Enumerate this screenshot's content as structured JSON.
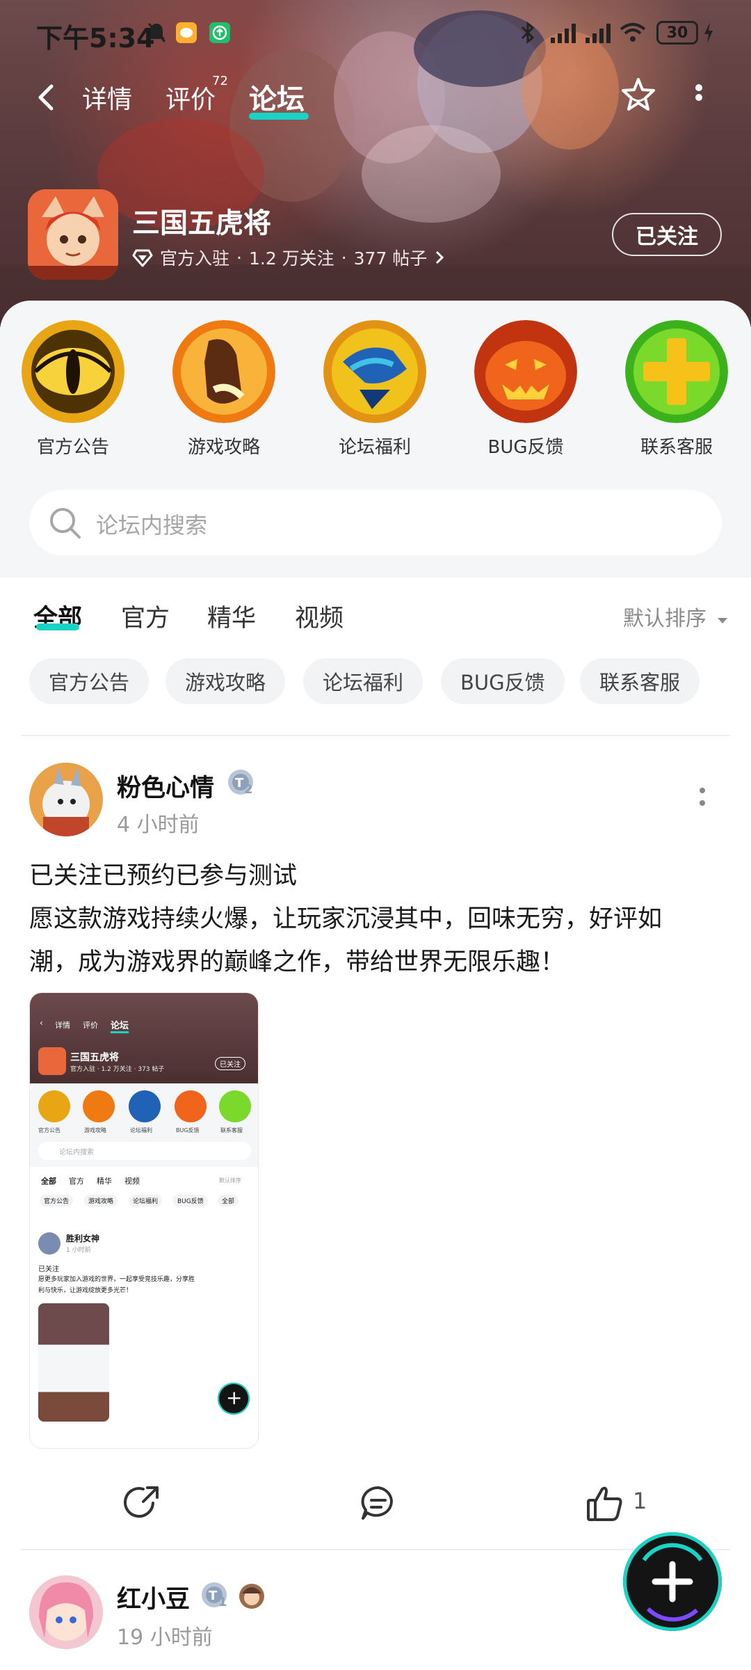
{
  "status_bar": {
    "time": "下午5:34",
    "battery": "30"
  },
  "top_nav": {
    "tabs": [
      {
        "label": "详情"
      },
      {
        "label": "评价",
        "badge": "72"
      },
      {
        "label": "论坛",
        "active": true
      }
    ]
  },
  "game": {
    "title": "三国五虎将",
    "official_label": "官方入驻",
    "followers": "1.2 万关注",
    "posts": "377 帖子",
    "follow_button": "已关注"
  },
  "quick_entries": [
    {
      "label": "官方公告",
      "icon": "cat-eye-icon"
    },
    {
      "label": "游戏攻略",
      "icon": "fist-icon"
    },
    {
      "label": "论坛福利",
      "icon": "gift-hand-icon"
    },
    {
      "label": "BUG反馈",
      "icon": "pumpkin-icon"
    },
    {
      "label": "联系客服",
      "icon": "plus-cross-icon"
    }
  ],
  "search": {
    "placeholder": "论坛内搜索"
  },
  "filter_tabs": [
    {
      "label": "全部",
      "active": true
    },
    {
      "label": "官方"
    },
    {
      "label": "精华"
    },
    {
      "label": "视频"
    }
  ],
  "sort_label": "默认排序",
  "chips": [
    "官方公告",
    "游戏攻略",
    "论坛福利",
    "BUG反馈",
    "联系客服"
  ],
  "posts": [
    {
      "author": "粉色心情",
      "level": "2",
      "time": "4 小时前",
      "lines": [
        "已关注已预约已参与测试",
        "愿这款游戏持续火爆，让玩家沉浸其中，回味无穷，好评如",
        "潮，成为游戏界的巅峰之作，带给世界无限乐趣！"
      ],
      "likes": "1"
    },
    {
      "author": "红小豆",
      "level": "1",
      "time": "19 小时前"
    }
  ],
  "thumb": {
    "nav": [
      "详情",
      "评价",
      "论坛"
    ],
    "title": "三国五虎将",
    "meta": "官方入驻 · 1.2 万关注 · 373 帖子",
    "follow": "已关注",
    "entries": [
      "官方公告",
      "游戏攻略",
      "论坛福利",
      "BUG反馈",
      "联系客服"
    ],
    "search": "论坛内搜索",
    "tabs": [
      "全部",
      "官方",
      "精华",
      "视频"
    ],
    "sort": "默认排序",
    "chips": [
      "官方公告",
      "游戏攻略",
      "论坛福利",
      "BUG反馈",
      "全部"
    ],
    "author": "胜利女神",
    "time": "1 小时前",
    "line1": "已关注",
    "line2": "愿更多玩家加入游戏的世界，一起享受竞技乐趣，分享胜",
    "line3": "利与快乐，让游戏绽放更多光芒！"
  },
  "colors": {
    "accent": "#19d3c5",
    "hero_bg": "#5b3b3d"
  }
}
